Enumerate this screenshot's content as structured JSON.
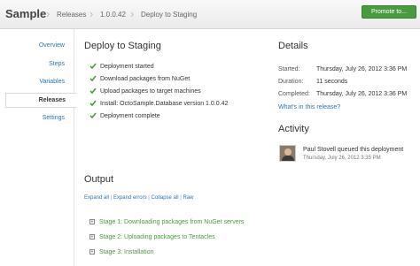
{
  "header": {
    "brand": "Sample",
    "breadcrumbs": [
      "Releases",
      "1.0.0.42",
      "Deploy to Staging"
    ],
    "promote_label": "Promote to..."
  },
  "sidebar": {
    "items": [
      "Overview",
      "Steps",
      "Variables",
      "Releases",
      "Settings"
    ],
    "active": "Releases"
  },
  "main": {
    "title": "Deploy to Staging",
    "steps": [
      "Deployment started",
      "Download packages from NuGet",
      "Upload packages to target machines",
      "Install: OctoSample.Database version 1.0.0.42",
      "Deployment complete"
    ]
  },
  "details": {
    "title": "Details",
    "rows": [
      {
        "label": "Started:",
        "value": "Thursday, July 26, 2012 3:36 PM"
      },
      {
        "label": "Duration:",
        "value": "11 seconds"
      },
      {
        "label": "Completed:",
        "value": "Thursday, July 26, 2012 3:36 PM"
      }
    ],
    "link": "What's in this release?"
  },
  "activity": {
    "title": "Activity",
    "message": "Paul Stovell queued this deployment",
    "timestamp": "Thursday, July 26, 2012 3:35 PM"
  },
  "output": {
    "title": "Output",
    "links": [
      "Expand all",
      "Expand errors",
      "Collapse all",
      "Raw"
    ],
    "stages": [
      "Stage 1: Downloading packages from NuGet servers",
      "Stage 2: Uploading packages to Tentacles",
      "Stage 3: Installation"
    ]
  },
  "colors": {
    "accent_green": "#4a9b3f",
    "link_blue": "#2a76b5"
  }
}
